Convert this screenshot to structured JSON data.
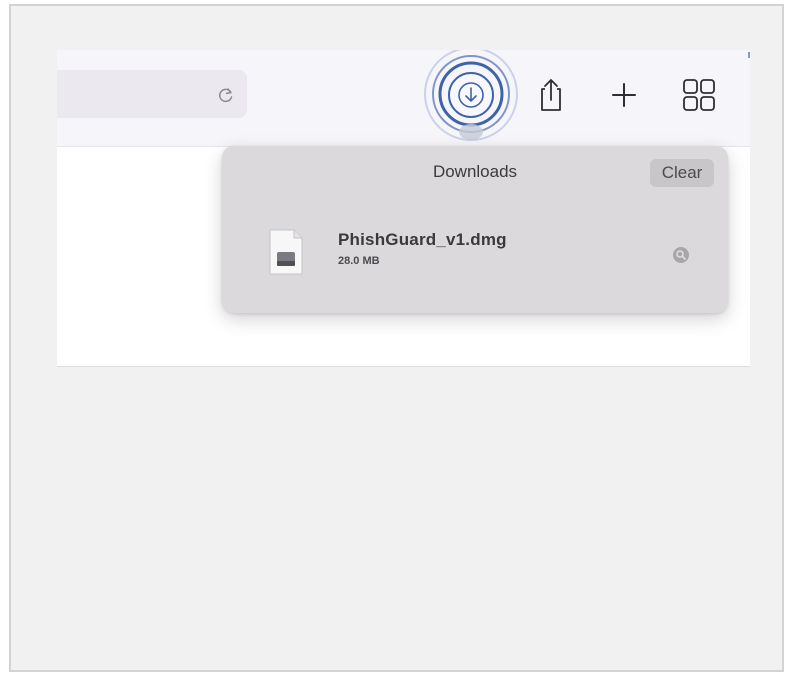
{
  "toolbar": {
    "reload_icon": "reload-icon",
    "downloads_icon": "download-arrow-icon",
    "share_icon": "share-icon",
    "new_tab_icon": "plus-icon",
    "tab_overview_icon": "grid-icon"
  },
  "downloads": {
    "title": "Downloads",
    "clear_label": "Clear",
    "items": [
      {
        "name": "PhishGuard_v1.dmg",
        "size": "28.0 MB",
        "file_icon": "dmg-file-icon",
        "action_icon": "magnifier-icon"
      }
    ]
  },
  "colors": {
    "accent": "#3f63a8",
    "popover_bg": "#dcd9dc",
    "toolbar_bg": "#f6f5f9",
    "page_bg": "#f1f1f2"
  }
}
